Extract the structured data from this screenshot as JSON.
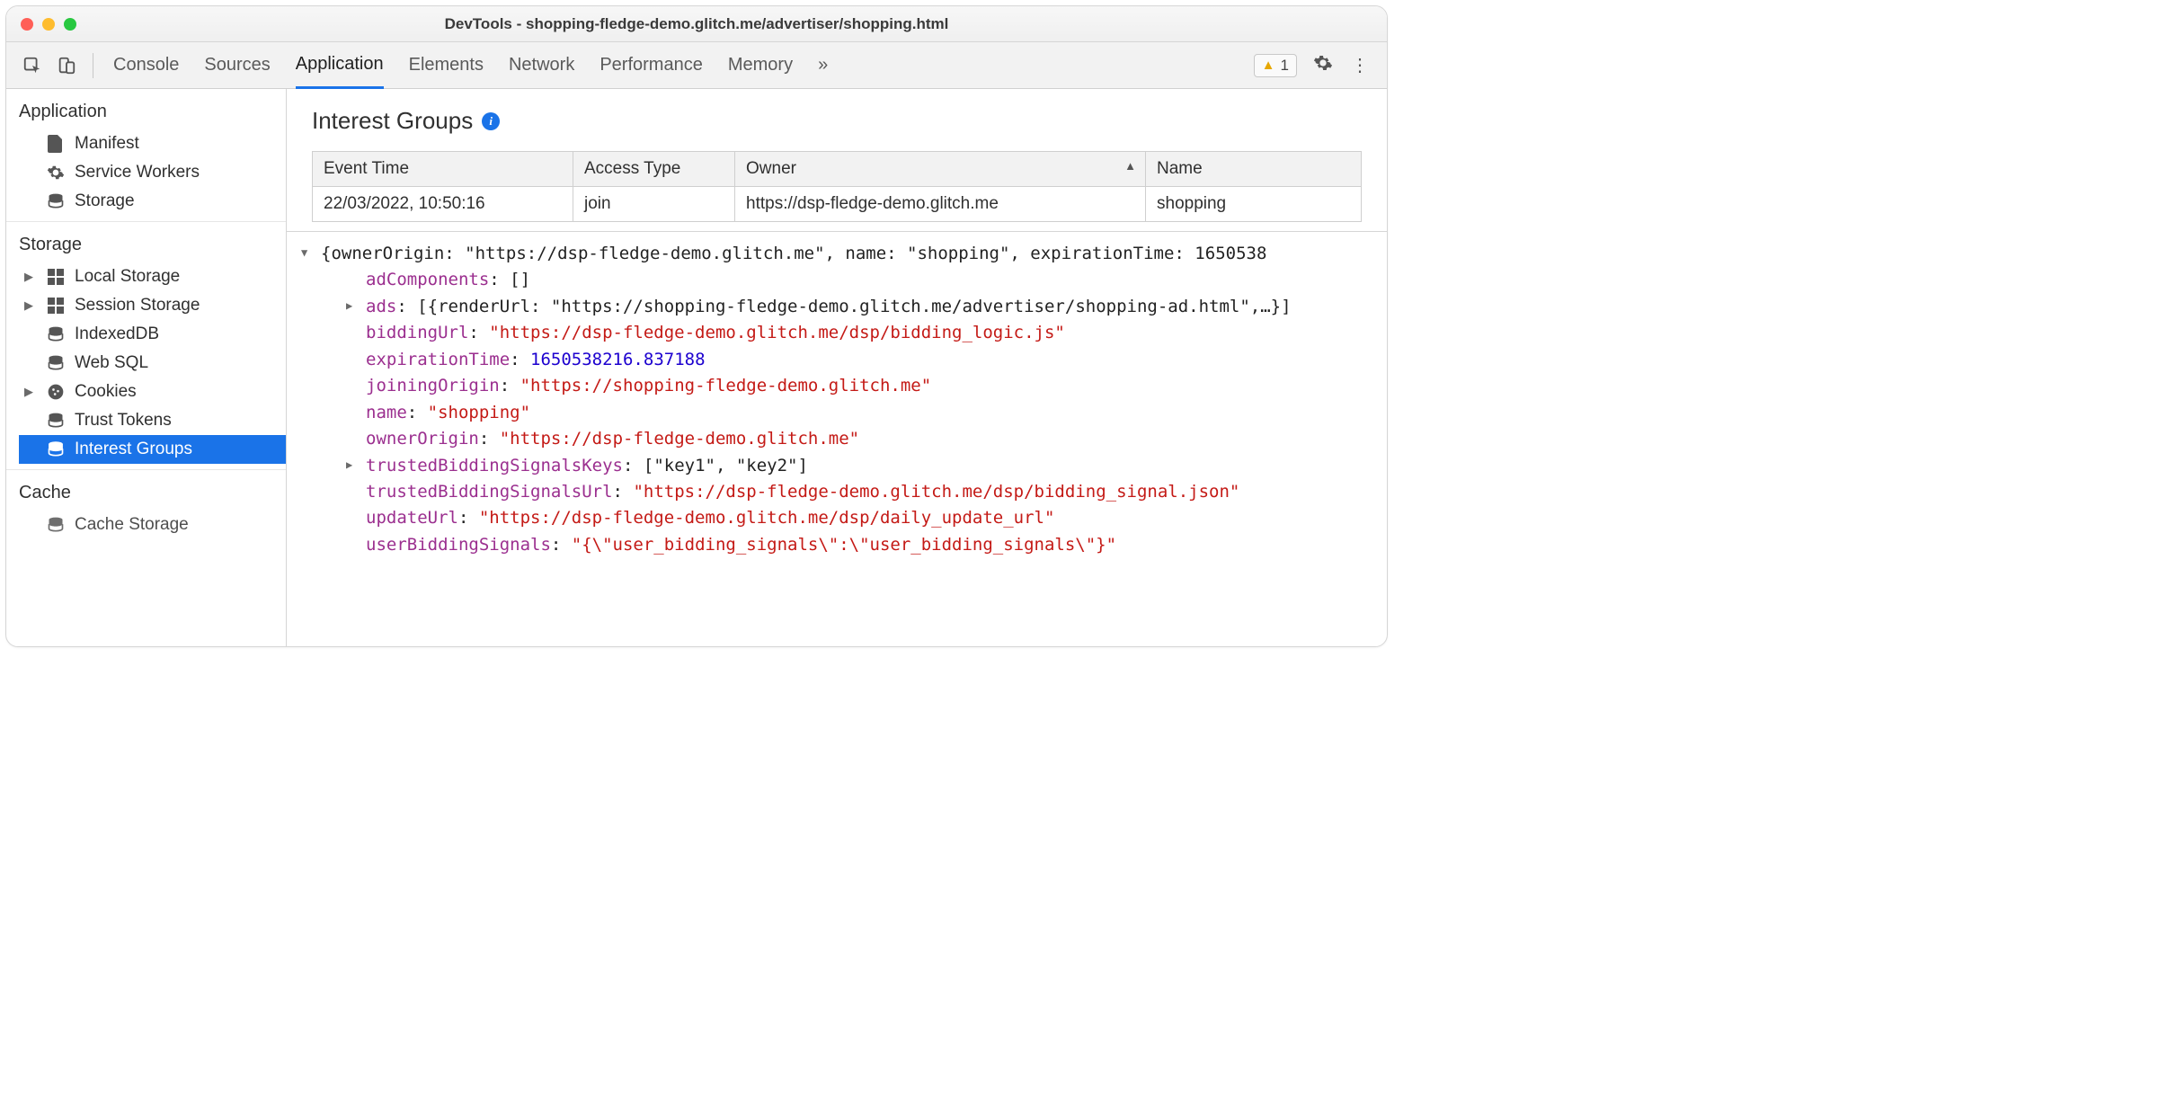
{
  "window": {
    "title": "DevTools - shopping-fledge-demo.glitch.me/advertiser/shopping.html"
  },
  "toolbar": {
    "tabs": [
      "Console",
      "Sources",
      "Application",
      "Elements",
      "Network",
      "Performance",
      "Memory"
    ],
    "active_tab": "Application",
    "overflow_glyph": "»",
    "warning_count": "1"
  },
  "sidebar": {
    "sections": [
      {
        "title": "Application",
        "items": [
          {
            "label": "Manifest",
            "icon": "file-icon"
          },
          {
            "label": "Service Workers",
            "icon": "gear-icon"
          },
          {
            "label": "Storage",
            "icon": "database-icon"
          }
        ]
      },
      {
        "title": "Storage",
        "items": [
          {
            "label": "Local Storage",
            "icon": "grid-icon",
            "expandable": true
          },
          {
            "label": "Session Storage",
            "icon": "grid-icon",
            "expandable": true
          },
          {
            "label": "IndexedDB",
            "icon": "database-icon"
          },
          {
            "label": "Web SQL",
            "icon": "database-icon"
          },
          {
            "label": "Cookies",
            "icon": "cookie-icon",
            "expandable": true
          },
          {
            "label": "Trust Tokens",
            "icon": "database-icon"
          },
          {
            "label": "Interest Groups",
            "icon": "database-icon",
            "selected": true
          }
        ]
      },
      {
        "title": "Cache",
        "items": [
          {
            "label": "Cache Storage",
            "icon": "database-icon"
          }
        ]
      }
    ]
  },
  "panel": {
    "title": "Interest Groups",
    "columns": [
      "Event Time",
      "Access Type",
      "Owner",
      "Name"
    ],
    "sorted_col": "Owner",
    "rows": [
      {
        "event_time": "22/03/2022, 10:50:16",
        "access_type": "join",
        "owner": "https://dsp-fledge-demo.glitch.me",
        "name": "shopping"
      }
    ]
  },
  "detail": {
    "root_line": "{ownerOrigin: \"https://dsp-fledge-demo.glitch.me\", name: \"shopping\", expirationTime: 1650538",
    "adComponents": "[]",
    "ads_line": "[{renderUrl: \"https://shopping-fledge-demo.glitch.me/advertiser/shopping-ad.html\",…}]",
    "biddingUrl": "\"https://dsp-fledge-demo.glitch.me/dsp/bidding_logic.js\"",
    "expirationTime": "1650538216.837188",
    "joiningOrigin": "\"https://shopping-fledge-demo.glitch.me\"",
    "name": "\"shopping\"",
    "ownerOrigin": "\"https://dsp-fledge-demo.glitch.me\"",
    "trustedBiddingSignalsKeys": "[\"key1\", \"key2\"]",
    "trustedBiddingSignalsUrl": "\"https://dsp-fledge-demo.glitch.me/dsp/bidding_signal.json\"",
    "updateUrl": "\"https://dsp-fledge-demo.glitch.me/dsp/daily_update_url\"",
    "userBiddingSignals": "\"{\\\"user_bidding_signals\\\":\\\"user_bidding_signals\\\"}\""
  }
}
